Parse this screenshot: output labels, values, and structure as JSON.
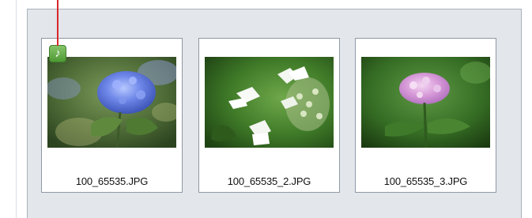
{
  "gallery": {
    "items": [
      {
        "filename": "100_65535.JPG",
        "has_music": true,
        "music_icon": "music-note-icon"
      },
      {
        "filename": "100_65535_2.JPG",
        "has_music": false
      },
      {
        "filename": "100_65535_3.JPG",
        "has_music": false
      }
    ]
  },
  "colors": {
    "panel_bg": "#e3e6ea",
    "thumb_border": "#8f99a6",
    "music_badge": "#5aa83c",
    "pointer": "#d7262b"
  },
  "icons": {
    "music_glyph": "♪"
  }
}
